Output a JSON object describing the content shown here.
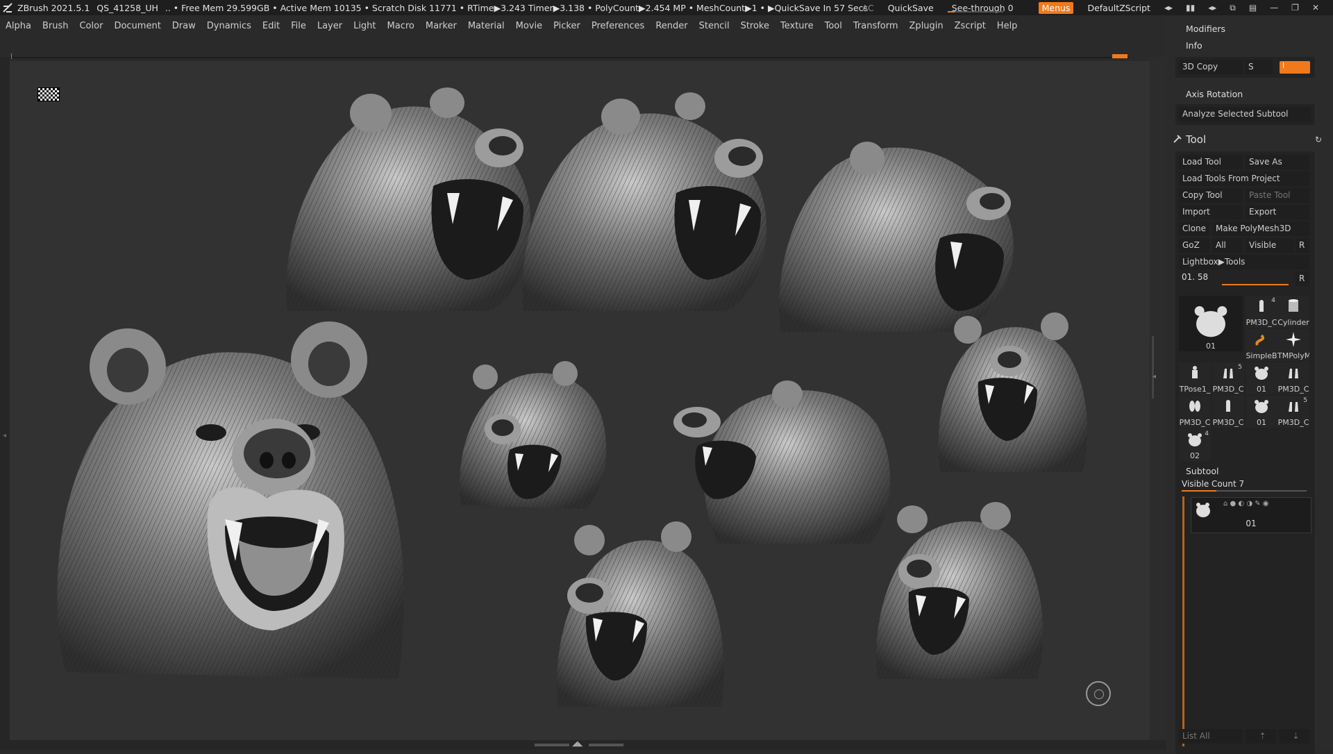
{
  "titlebar": {
    "app": "ZBrush 2021.5.1",
    "doc": "QS_41258_UH",
    "status": ".. • Free Mem 29.599GB • Active Mem 10135 • Scratch Disk 11771 • RTime▶3.243 Timer▶3.138 • PolyCount▶2.454 MP • MeshCount▶1 • ▶QuickSave In 57 Secs",
    "ac": "AC",
    "quicksave": "QuickSave",
    "seethrough": "See-through  0",
    "menus": "Menus",
    "script": "DefaultZScript"
  },
  "menubar": [
    "Alpha",
    "Brush",
    "Color",
    "Document",
    "Draw",
    "Dynamics",
    "Edit",
    "File",
    "Layer",
    "Light",
    "Macro",
    "Marker",
    "Material",
    "Movie",
    "Picker",
    "Preferences",
    "Render",
    "Stencil",
    "Stroke",
    "Texture",
    "Tool",
    "Transform",
    "Zplugin",
    "Zscript",
    "Help"
  ],
  "panel": {
    "modifiers": "Modifiers",
    "info": "Info",
    "copy3d": "3D Copy",
    "s": "S",
    "cursor": "I",
    "axis_rotation": "Axis Rotation",
    "analyze": "Analyze Selected Subtool",
    "tool_title": "Tool",
    "load_tool": "Load Tool",
    "save_as": "Save As",
    "load_from_project": "Load Tools From Project",
    "copy_tool": "Copy Tool",
    "paste_tool": "Paste Tool",
    "import": "Import",
    "export": "Export",
    "clone": "Clone",
    "make_polymesh": "Make PolyMesh3D",
    "goz": "GoZ",
    "all": "All",
    "visible": "Visible",
    "r": "R",
    "lightbox": "Lightbox▶Tools",
    "slider_label": "01. 58",
    "slider_r": "R",
    "tools_grid": [
      {
        "label": "01",
        "num": ""
      },
      {
        "label": "PM3D_C",
        "num": "4"
      },
      {
        "label": "Cylinder",
        "num": ""
      },
      {
        "label": "SimpleB",
        "num": ""
      },
      {
        "label": "TMPolyM",
        "num": ""
      },
      {
        "label": "TPose1_",
        "num": ""
      },
      {
        "label": "PM3D_C",
        "num": "5"
      },
      {
        "label": "01",
        "num": ""
      },
      {
        "label": "PM3D_C",
        "num": ""
      },
      {
        "label": "PM3D_C",
        "num": ""
      },
      {
        "label": "PM3D_C",
        "num": ""
      },
      {
        "label": "01",
        "num": ""
      },
      {
        "label": "PM3D_C",
        "num": "5"
      },
      {
        "label": "02",
        "num": "4"
      }
    ],
    "subtool_title": "Subtool",
    "visible_count": "Visible Count 7",
    "subtool_item": "01",
    "list_all": "List All"
  }
}
